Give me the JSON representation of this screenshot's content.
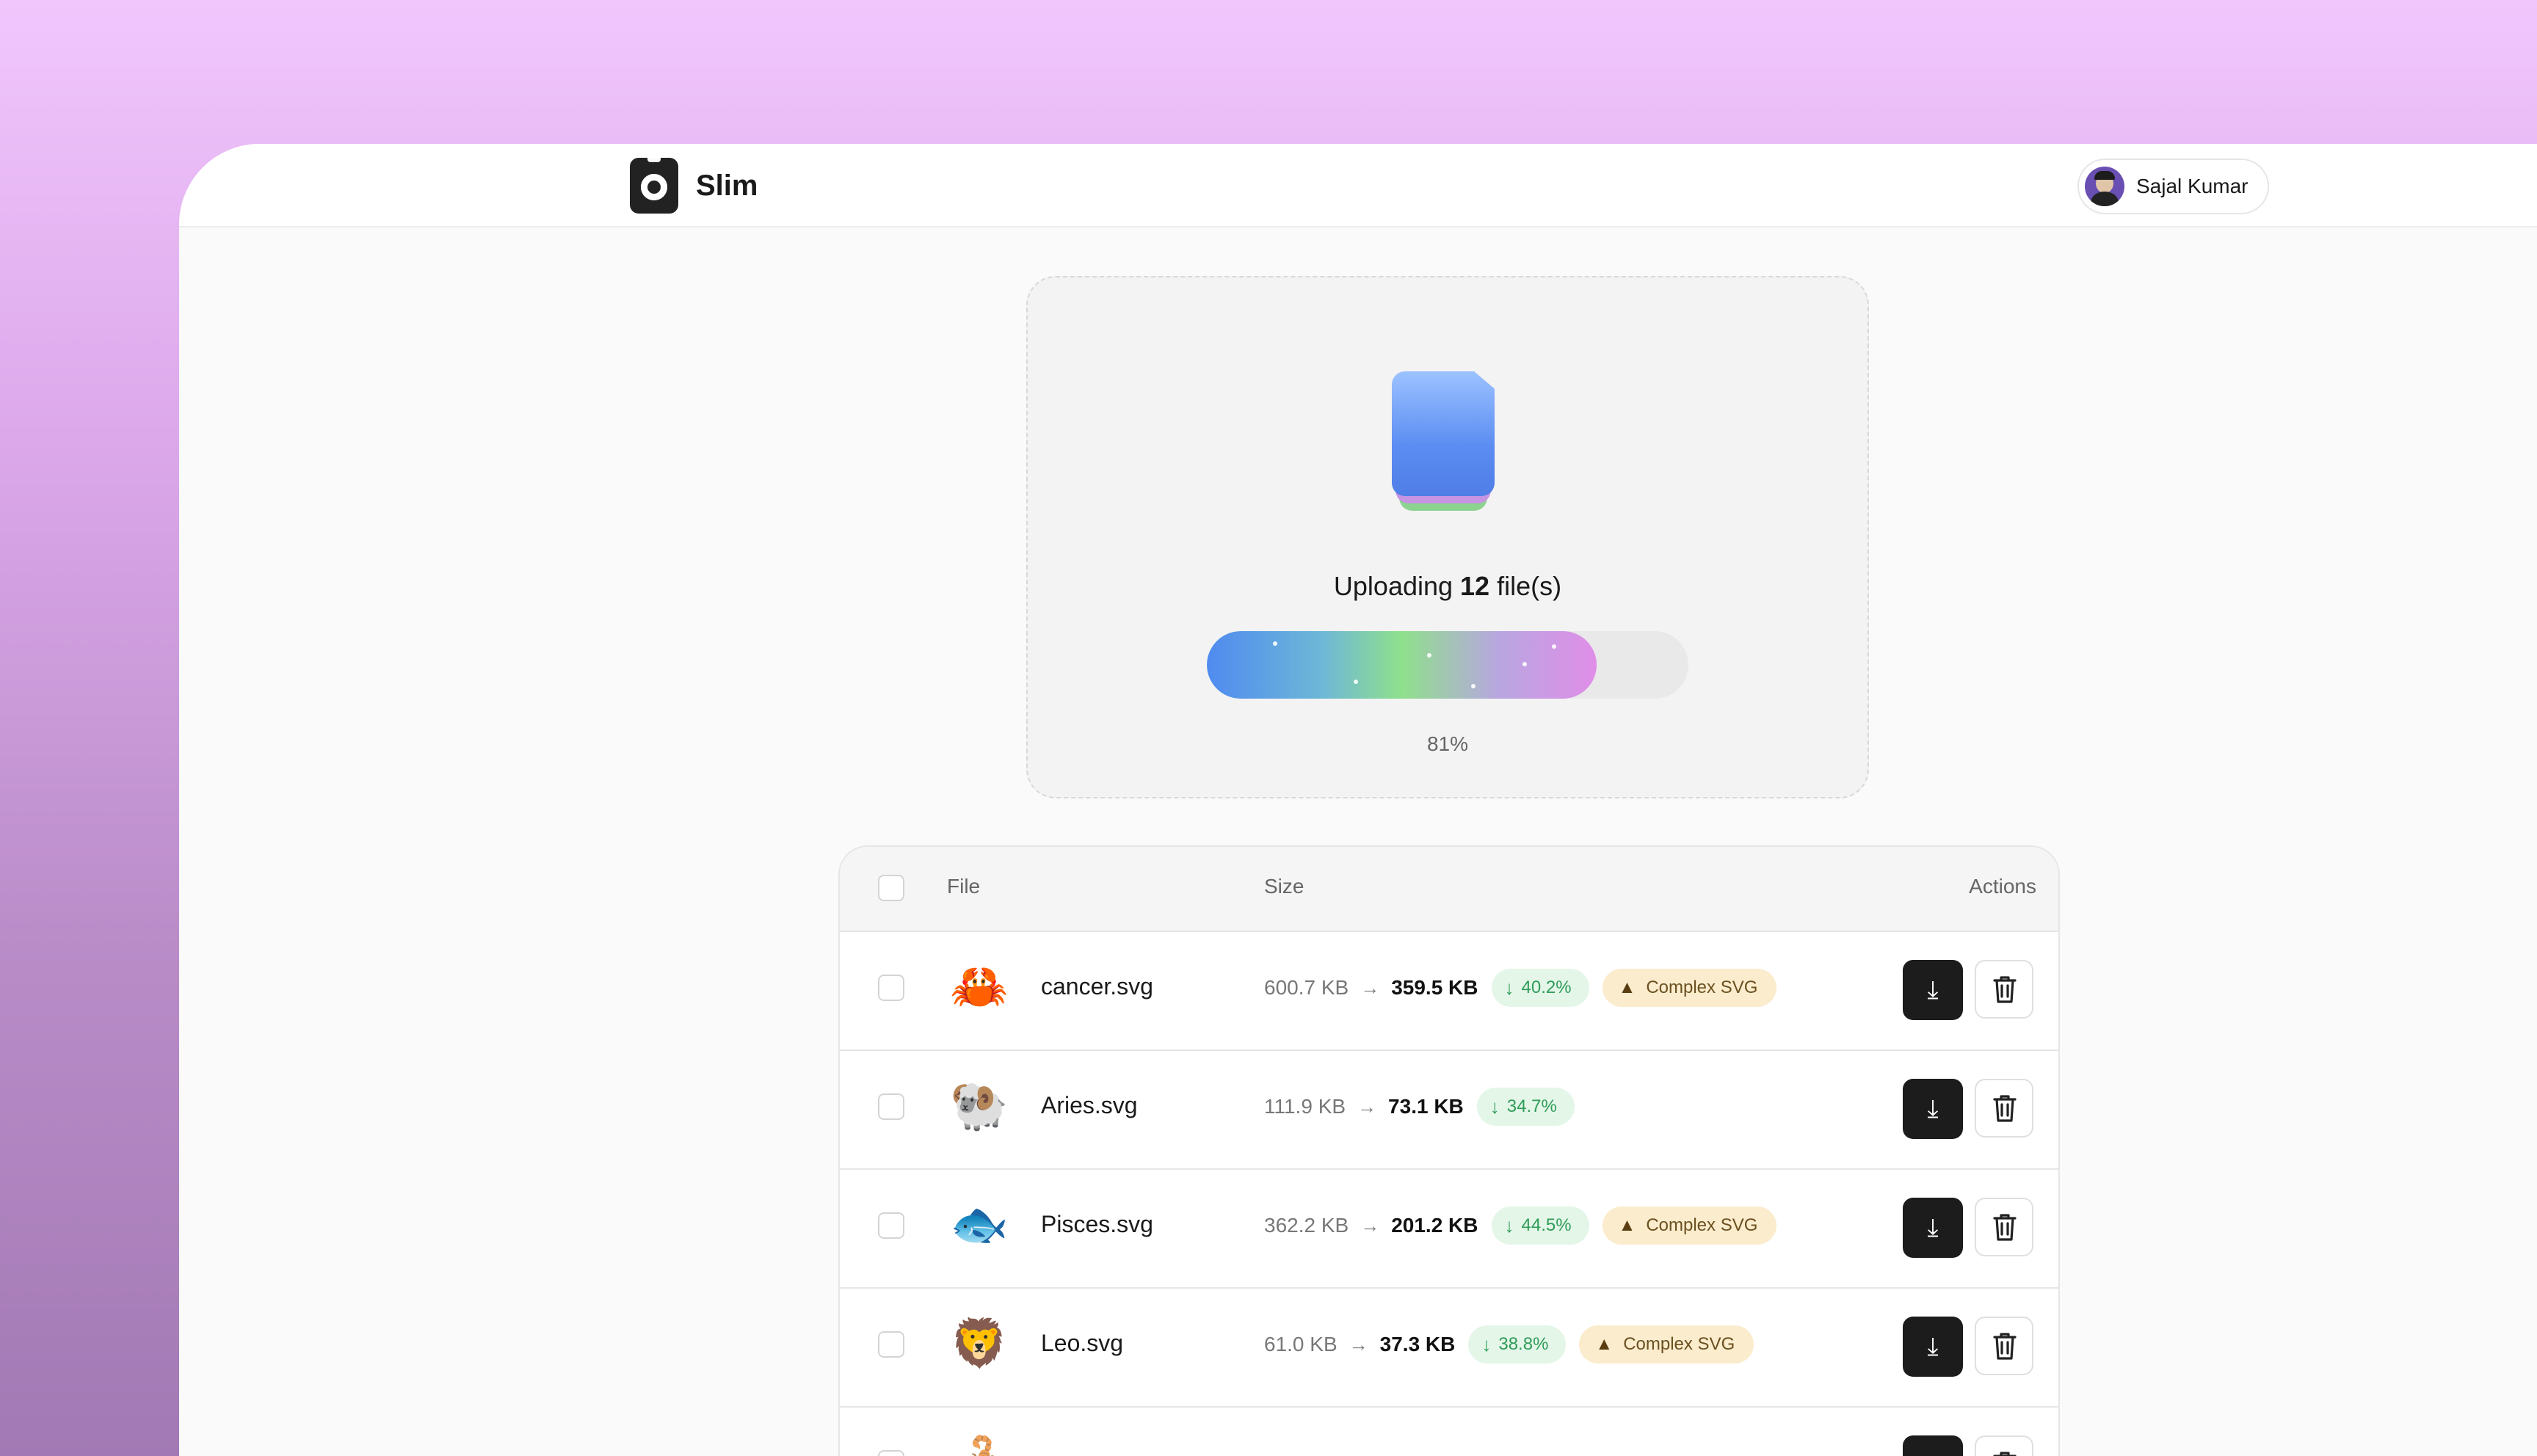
{
  "app": {
    "name": "Slim"
  },
  "user": {
    "name": "Sajal Kumar"
  },
  "upload": {
    "label_prefix": "Uploading ",
    "count": "12",
    "label_suffix": " file(s)",
    "progress": 0.81,
    "progress_text": "81%"
  },
  "table": {
    "headers": {
      "file": "File",
      "size": "Size",
      "actions": "Actions"
    },
    "rows": [
      {
        "icon": "crab-icon",
        "emoji": "🦀",
        "name": "cancer.svg",
        "original": "600.7 KB",
        "compressed": "359.5 KB",
        "reduction": "40.2%",
        "warning": "Complex SVG"
      },
      {
        "icon": "ram-icon",
        "emoji": "🐏",
        "name": "Aries.svg",
        "original": "111.9 KB",
        "compressed": "73.1 KB",
        "reduction": "34.7%",
        "warning": ""
      },
      {
        "icon": "fish-icon",
        "emoji": "🐟",
        "name": "Pisces.svg",
        "original": "362.2 KB",
        "compressed": "201.2 KB",
        "reduction": "44.5%",
        "warning": "Complex SVG"
      },
      {
        "icon": "lion-icon",
        "emoji": "🦁",
        "name": "Leo.svg",
        "original": "61.0 KB",
        "compressed": "37.3 KB",
        "reduction": "38.8%",
        "warning": "Complex SVG"
      },
      {
        "icon": "scorpion-icon",
        "emoji": "🦂",
        "name": "",
        "original": "",
        "compressed": "",
        "reduction": "",
        "warning": ""
      }
    ]
  },
  "colors": {
    "accent_green": "#2f9c58",
    "warning_bg": "#fbeccd",
    "progress_start": "#4f8bf0",
    "progress_end": "#e08ee8"
  }
}
